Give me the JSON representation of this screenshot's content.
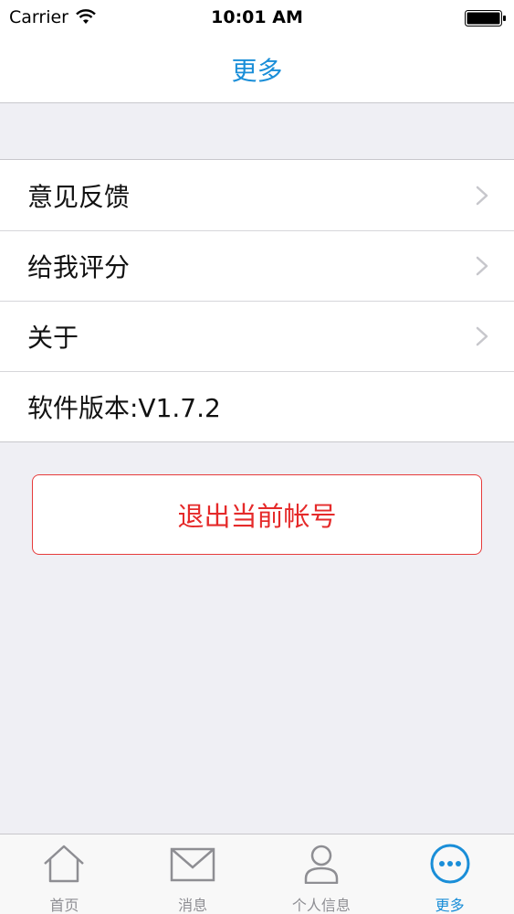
{
  "status_bar": {
    "carrier": "Carrier",
    "time": "10:01 AM"
  },
  "nav": {
    "title": "更多"
  },
  "list": {
    "items": [
      {
        "label": "意见反馈"
      },
      {
        "label": "给我评分"
      },
      {
        "label": "关于"
      },
      {
        "label": "软件版本:V1.7.2"
      }
    ]
  },
  "logout": {
    "label": "退出当前帐号"
  },
  "tabs": [
    {
      "label": "首页",
      "icon": "home-icon"
    },
    {
      "label": "消息",
      "icon": "mail-icon"
    },
    {
      "label": "个人信息",
      "icon": "person-icon"
    },
    {
      "label": "更多",
      "icon": "more-icon",
      "active": true
    }
  ],
  "colors": {
    "accent": "#1a8ed8",
    "danger": "#e52a2a",
    "background": "#efeff4"
  }
}
